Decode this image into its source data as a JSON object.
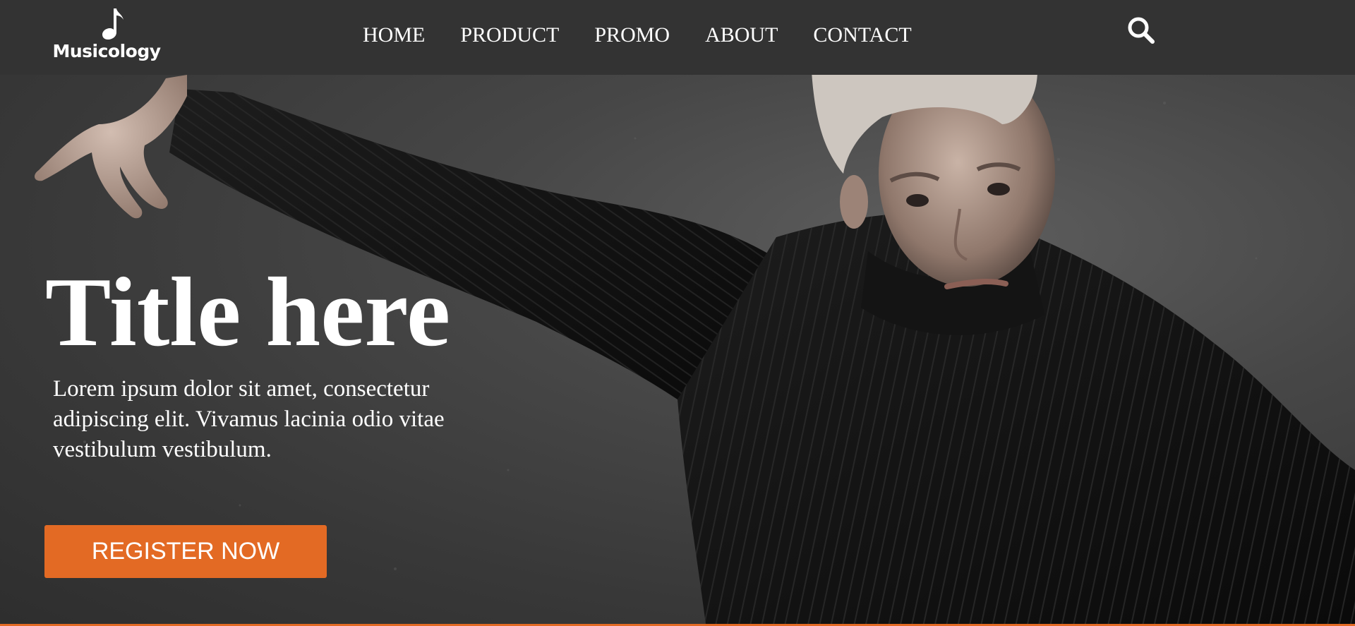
{
  "brand": {
    "logo_text": "Musicology",
    "logo_icon": "music-note-icon"
  },
  "nav": {
    "items": [
      {
        "label": "HOME"
      },
      {
        "label": "PRODUCT"
      },
      {
        "label": "PROMO"
      },
      {
        "label": "ABOUT"
      },
      {
        "label": "CONTACT"
      }
    ],
    "search_icon": "search-icon"
  },
  "hero": {
    "title": "Title here",
    "text": "Lorem ipsum dolor sit amet, consectetur adipiscing elit. Vivamus lacinia odio vitae vestibulum vestibulum.",
    "cta_label": "REGISTER NOW"
  },
  "colors": {
    "navbar": "#333333",
    "accent": "#e36a24",
    "text": "#ffffff"
  }
}
